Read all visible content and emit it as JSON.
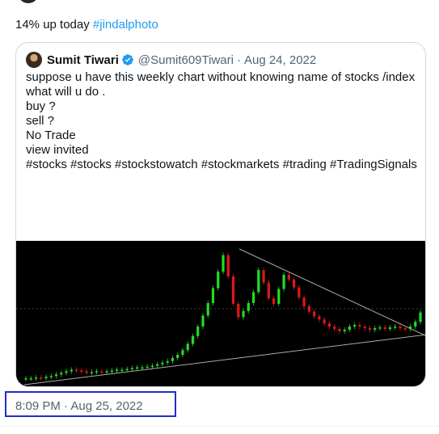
{
  "tweet": {
    "text": "14% up today ",
    "hashtag": "#jindalphoto"
  },
  "quote": {
    "author_name": "Sumit Tiwari",
    "handle": "@Sumit609Tiwari",
    "separator": "·",
    "date": "Aug 24, 2022",
    "lines": [
      "suppose u have this weekly chart without knowing name of stocks /index",
      "what will u do .",
      "",
      "buy ?",
      "sell ?",
      "",
      "No Trade",
      "",
      "view invited",
      "",
      "#stocks #stocks #stockstowatch #stockmarkets #trading #TradingSignals"
    ]
  },
  "timestamp": "8:09 PM · Aug 25, 2022",
  "colors": {
    "link": "#1d9bf0",
    "verified": "#1d9bf0",
    "up_candle": "#22dd22",
    "down_candle": "#e01818",
    "highlight_box": "#1f2fc7"
  },
  "icons": {
    "verified": "verified-badge-icon"
  },
  "chart_data": {
    "type": "candlestick",
    "note_visible_labels": "none",
    "series": [
      {
        "values": [
          1.0,
          1.0,
          1.1,
          1.0,
          1.2,
          1.3,
          1.5,
          1.7,
          1.9,
          2.1,
          2.0,
          1.9,
          1.7,
          1.8,
          1.9,
          1.8,
          1.9,
          2.0,
          2.1,
          2.1,
          2.2,
          2.3,
          2.4,
          2.4,
          2.5,
          2.6,
          2.8,
          3.0,
          3.2,
          3.6,
          4.0,
          4.6,
          5.4,
          6.4,
          7.6,
          9.0,
          10.6,
          12.5,
          14.6,
          16.7,
          14.0,
          10.5,
          8.8,
          9.6,
          10.6,
          12.0,
          14.8,
          13.2,
          11.2,
          10.5,
          12.4,
          14.2,
          13.6,
          12.6,
          11.3,
          10.2,
          9.5,
          8.9,
          8.5,
          8.0,
          7.6,
          7.3,
          7.0,
          7.2,
          7.6,
          7.8,
          7.6,
          7.4,
          7.2,
          7.4,
          7.5,
          7.3,
          7.5,
          7.6,
          7.4,
          7.3,
          7.6,
          8.2,
          9.4
        ]
      }
    ]
  }
}
